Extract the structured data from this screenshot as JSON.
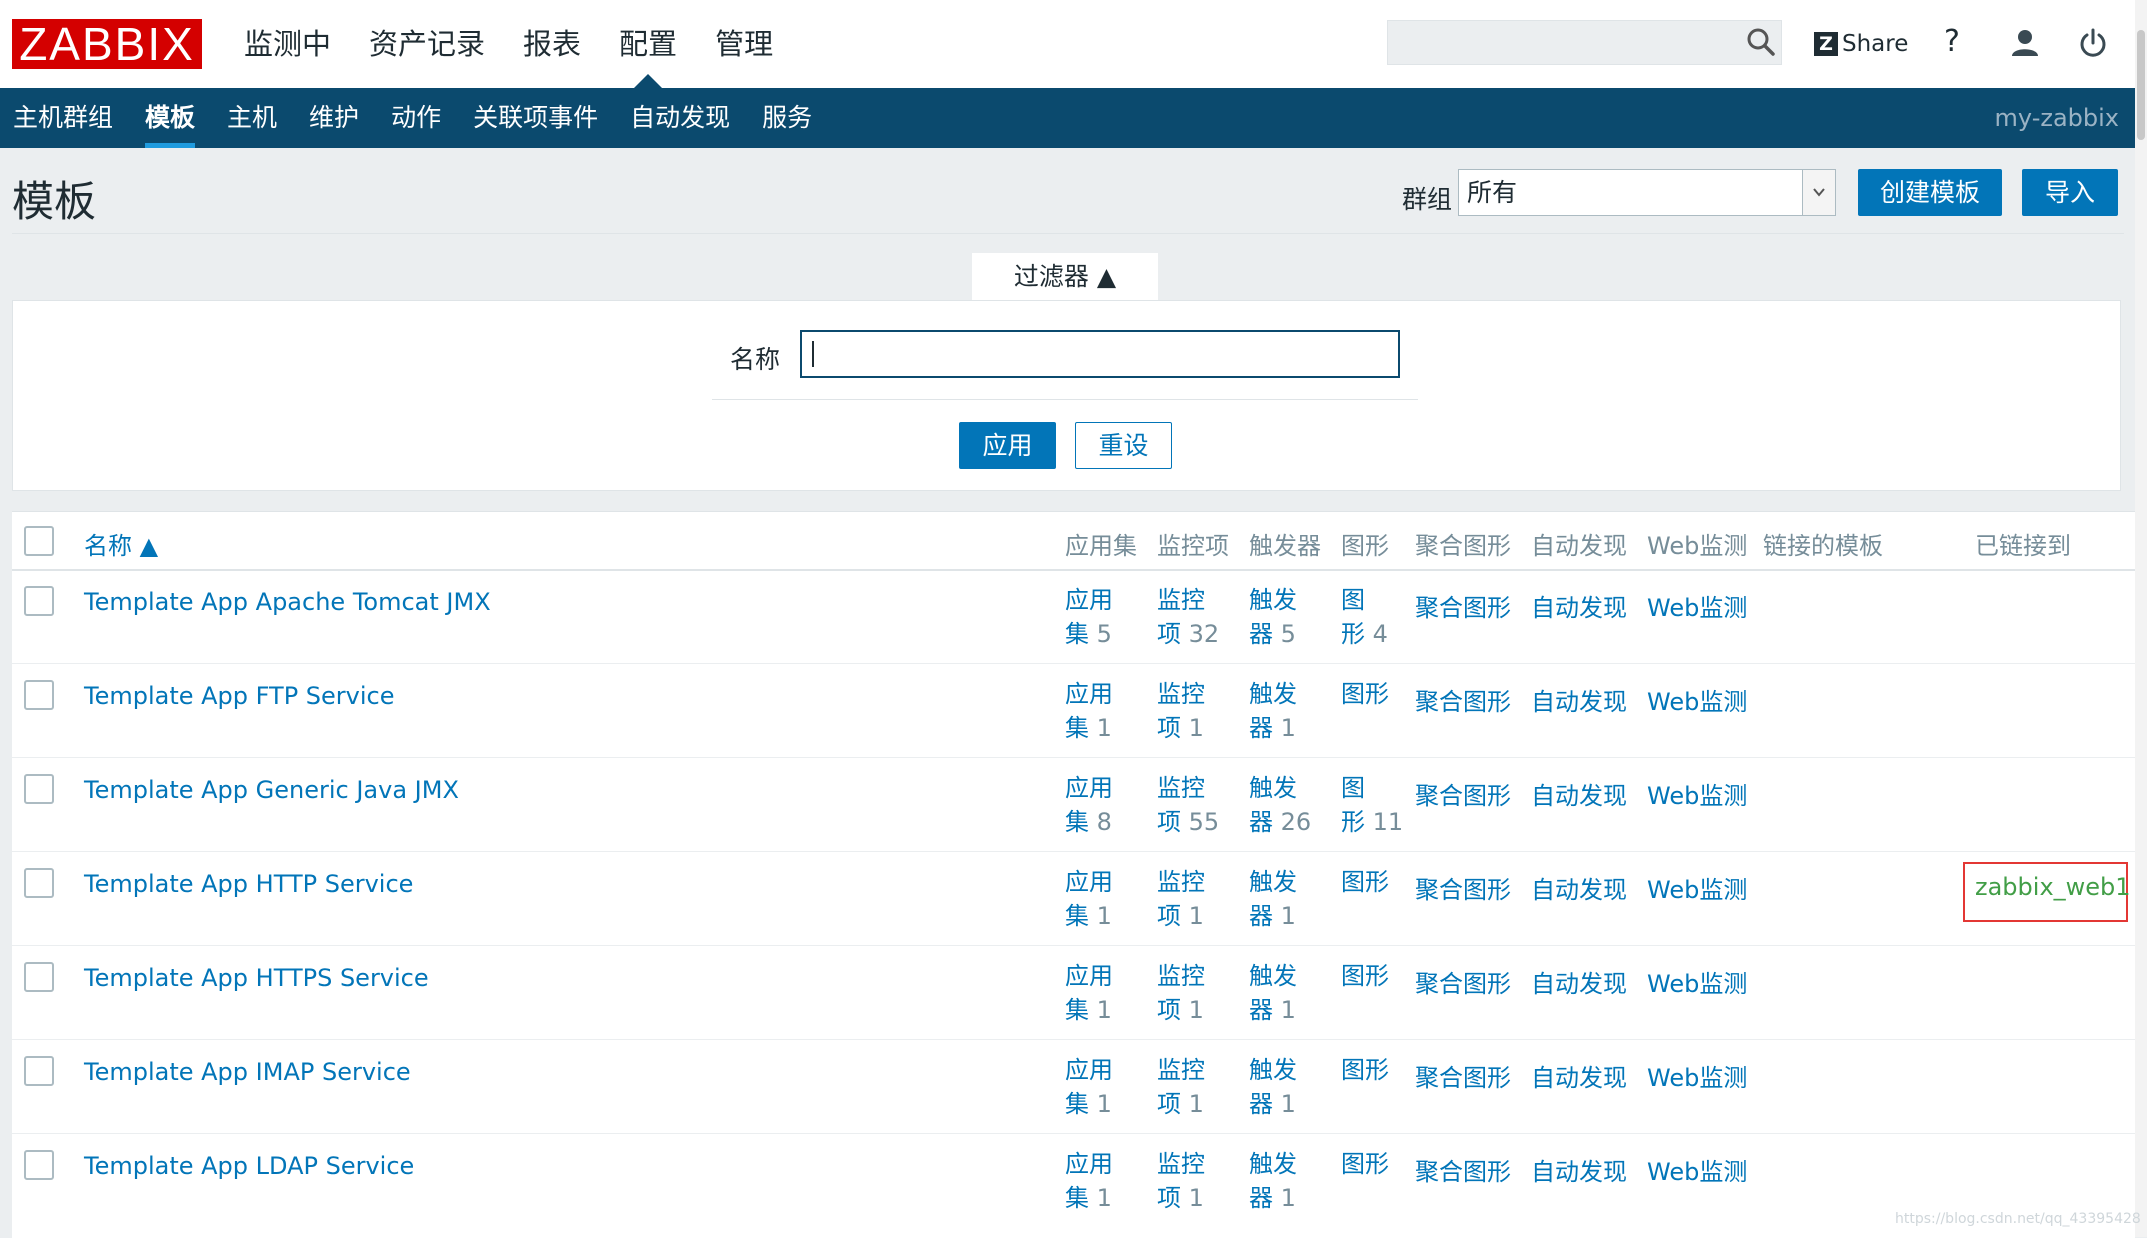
{
  "brand": {
    "logo": "ZABBIX"
  },
  "main_menu": [
    "监测中",
    "资产记录",
    "报表",
    "配置",
    "管理"
  ],
  "top_right": {
    "share": "Share",
    "help": "?"
  },
  "sub_menu": [
    "主机群组",
    "模板",
    "主机",
    "维护",
    "动作",
    "关联项事件",
    "自动发现",
    "服务"
  ],
  "server_name": "my-zabbix",
  "page": {
    "title": "模板",
    "group_label": "群组",
    "group_value": "所有",
    "create_button": "创建模板",
    "import_button": "导入"
  },
  "filter": {
    "tab_label": "过滤器 ▲",
    "name_label": "名称",
    "name_value": "",
    "apply_button": "应用",
    "reset_button": "重设"
  },
  "table": {
    "headers": {
      "name": "名称 ▲",
      "apps": "应用集",
      "items": "监控项",
      "triggers": "触发器",
      "graphs": "图形",
      "screens": "聚合图形",
      "discovery": "自动发现",
      "web": "Web监测",
      "linked_templates": "链接的模板",
      "linked_to": "已链接到"
    },
    "rows": [
      {
        "name": "Template App Apache Tomcat JMX",
        "apps_l1": "应用",
        "apps_l2": "集",
        "apps_count": "5",
        "items_l1": "监控",
        "items_l2": "项",
        "items_count": "32",
        "triggers_l1": "触发",
        "triggers_l2": "器",
        "triggers_count": "5",
        "graphs_l1": "图",
        "graphs_l2": "形",
        "graphs_count": "4",
        "screens": "聚合图形",
        "discovery": "自动发现",
        "web": "Web监测",
        "linked_to": ""
      },
      {
        "name": "Template App FTP Service",
        "apps_l1": "应用",
        "apps_l2": "集",
        "apps_count": "1",
        "items_l1": "监控",
        "items_l2": "项",
        "items_count": "1",
        "triggers_l1": "触发",
        "triggers_l2": "器",
        "triggers_count": "1",
        "graphs_l1": "图形",
        "graphs_l2": "",
        "graphs_count": "",
        "screens": "聚合图形",
        "discovery": "自动发现",
        "web": "Web监测",
        "linked_to": ""
      },
      {
        "name": "Template App Generic Java JMX",
        "apps_l1": "应用",
        "apps_l2": "集",
        "apps_count": "8",
        "items_l1": "监控",
        "items_l2": "项",
        "items_count": "55",
        "triggers_l1": "触发",
        "triggers_l2": "器",
        "triggers_count": "26",
        "graphs_l1": "图",
        "graphs_l2": "形",
        "graphs_count": "11",
        "screens": "聚合图形",
        "discovery": "自动发现",
        "web": "Web监测",
        "linked_to": ""
      },
      {
        "name": "Template App HTTP Service",
        "apps_l1": "应用",
        "apps_l2": "集",
        "apps_count": "1",
        "items_l1": "监控",
        "items_l2": "项",
        "items_count": "1",
        "triggers_l1": "触发",
        "triggers_l2": "器",
        "triggers_count": "1",
        "graphs_l1": "图形",
        "graphs_l2": "",
        "graphs_count": "",
        "screens": "聚合图形",
        "discovery": "自动发现",
        "web": "Web监测",
        "linked_to": "zabbix_web1"
      },
      {
        "name": "Template App HTTPS Service",
        "apps_l1": "应用",
        "apps_l2": "集",
        "apps_count": "1",
        "items_l1": "监控",
        "items_l2": "项",
        "items_count": "1",
        "triggers_l1": "触发",
        "triggers_l2": "器",
        "triggers_count": "1",
        "graphs_l1": "图形",
        "graphs_l2": "",
        "graphs_count": "",
        "screens": "聚合图形",
        "discovery": "自动发现",
        "web": "Web监测",
        "linked_to": ""
      },
      {
        "name": "Template App IMAP Service",
        "apps_l1": "应用",
        "apps_l2": "集",
        "apps_count": "1",
        "items_l1": "监控",
        "items_l2": "项",
        "items_count": "1",
        "triggers_l1": "触发",
        "triggers_l2": "器",
        "triggers_count": "1",
        "graphs_l1": "图形",
        "graphs_l2": "",
        "graphs_count": "",
        "screens": "聚合图形",
        "discovery": "自动发现",
        "web": "Web监测",
        "linked_to": ""
      },
      {
        "name": "Template App LDAP Service",
        "apps_l1": "应用",
        "apps_l2": "集",
        "apps_count": "1",
        "items_l1": "监控",
        "items_l2": "项",
        "items_count": "1",
        "triggers_l1": "触发",
        "triggers_l2": "器",
        "triggers_count": "1",
        "graphs_l1": "图形",
        "graphs_l2": "",
        "graphs_count": "",
        "screens": "聚合图形",
        "discovery": "自动发现",
        "web": "Web监测",
        "linked_to": ""
      }
    ]
  },
  "watermark": "https://blog.csdn.net/qq_43395428"
}
